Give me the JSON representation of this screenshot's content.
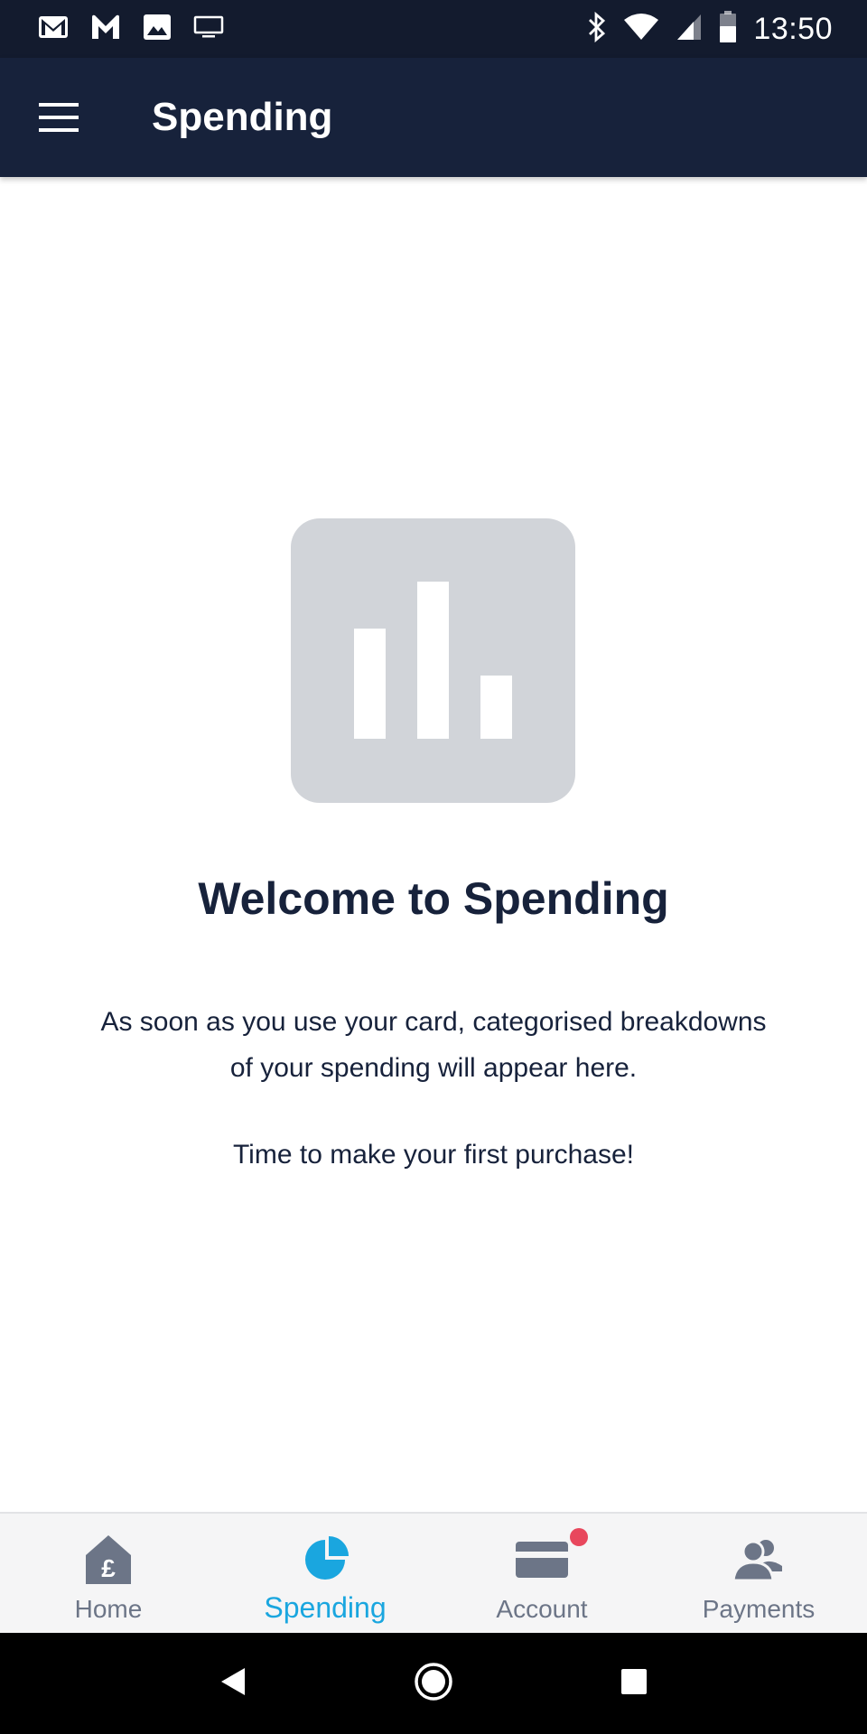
{
  "status_bar": {
    "time": "13:50",
    "left_icons": [
      "gmail-icon",
      "mega-icon",
      "gallery-icon",
      "cast-icon"
    ],
    "right_icons": [
      "bluetooth-icon",
      "wifi-icon",
      "signal-icon",
      "battery-icon"
    ]
  },
  "app_bar": {
    "title": "Spending"
  },
  "empty_state": {
    "icon": "bar-chart-icon",
    "title": "Welcome to Spending",
    "description": "As soon as you use your card, categorised breakdowns of your spending will appear here.",
    "cta": "Time to make your first purchase!"
  },
  "bottom_nav": {
    "items": [
      {
        "label": "Home",
        "icon": "home-pound-icon",
        "active": false
      },
      {
        "label": "Spending",
        "icon": "pie-chart-icon",
        "active": true
      },
      {
        "label": "Account",
        "icon": "card-icon",
        "active": false,
        "notification": true
      },
      {
        "label": "Payments",
        "icon": "people-icon",
        "active": false
      }
    ]
  },
  "colors": {
    "status_bar": "#131b2e",
    "app_bar": "#17223b",
    "accent": "#1aa6df",
    "text_dark": "#17223b",
    "inactive": "#6c7587",
    "notification": "#e8475d",
    "empty_icon_bg": "#d1d4d9"
  }
}
